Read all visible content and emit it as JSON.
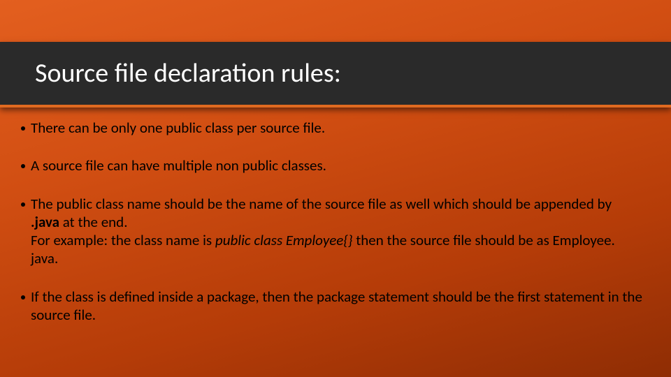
{
  "title": "Source file declaration rules:",
  "bullets": {
    "b1": "There can be only one public class per source file.",
    "b2": "A source file can have multiple non public classes.",
    "b3_part1": "The public class name should be the name of the source file as well which should be appended by ",
    "b3_bold": ".java",
    "b3_part2": " at the end.",
    "b3_example_lead": "For example: the class name is ",
    "b3_example_italic": "public class Employee{}",
    "b3_example_tail": " then the source file should be as Employee. java.",
    "b4": "If the class is defined inside a package, then the package statement should be the first statement in the source file."
  }
}
